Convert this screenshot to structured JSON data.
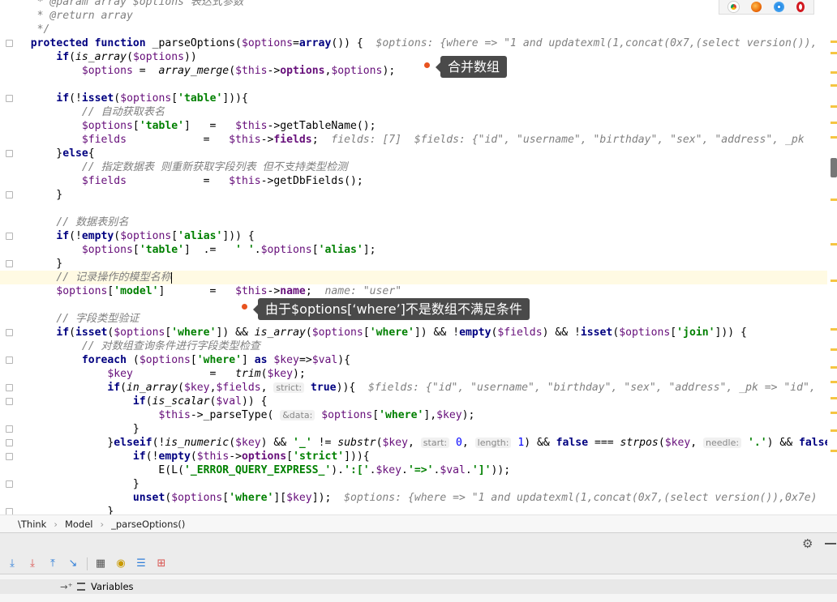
{
  "code_lines": [
    [
      [
        "doc",
        "   * "
      ],
      [
        "doc",
        "@param"
      ],
      [
        "doc",
        " array $options 表达式参数"
      ]
    ],
    [
      [
        "doc",
        "   * "
      ],
      [
        "doc",
        "@return"
      ],
      [
        "doc",
        " array"
      ]
    ],
    [
      [
        "doc",
        "   */"
      ]
    ],
    [
      [
        "plain",
        "  "
      ],
      [
        "kw",
        "protected function "
      ],
      [
        "plain",
        "_parseOptions("
      ],
      [
        "var",
        "$options"
      ],
      [
        "plain",
        "="
      ],
      [
        "kw",
        "array"
      ],
      [
        "plain",
        "()) {  "
      ],
      [
        "inl",
        "$options: {where => \"1 and updatexml(1,concat(0x7,(select version()),"
      ]
    ],
    [
      [
        "plain",
        "      "
      ],
      [
        "kw",
        "if"
      ],
      [
        "plain",
        "("
      ],
      [
        "fn",
        "is_array"
      ],
      [
        "plain",
        "("
      ],
      [
        "var",
        "$options"
      ],
      [
        "plain",
        "))"
      ]
    ],
    [
      [
        "plain",
        "          "
      ],
      [
        "var",
        "$options"
      ],
      [
        "plain",
        " =  "
      ],
      [
        "fn",
        "array_merge"
      ],
      [
        "plain",
        "("
      ],
      [
        "var",
        "$this"
      ],
      [
        "plain",
        "->"
      ],
      [
        "fld",
        "options"
      ],
      [
        "plain",
        ","
      ],
      [
        "var",
        "$options"
      ],
      [
        "plain",
        ");"
      ]
    ],
    [
      [
        "plain",
        ""
      ]
    ],
    [
      [
        "plain",
        "      "
      ],
      [
        "kw",
        "if"
      ],
      [
        "plain",
        "(!"
      ],
      [
        "kw",
        "isset"
      ],
      [
        "plain",
        "("
      ],
      [
        "var",
        "$options"
      ],
      [
        "plain",
        "["
      ],
      [
        "str",
        "'table'"
      ],
      [
        "plain",
        "])){"
      ]
    ],
    [
      [
        "plain",
        "          "
      ],
      [
        "com",
        "// 自动获取表名"
      ]
    ],
    [
      [
        "plain",
        "          "
      ],
      [
        "var",
        "$options"
      ],
      [
        "plain",
        "["
      ],
      [
        "str",
        "'table'"
      ],
      [
        "plain",
        "]   =   "
      ],
      [
        "var",
        "$this"
      ],
      [
        "plain",
        "->getTableName();"
      ]
    ],
    [
      [
        "plain",
        "          "
      ],
      [
        "var",
        "$fields"
      ],
      [
        "plain",
        "            =   "
      ],
      [
        "var",
        "$this"
      ],
      [
        "plain",
        "->"
      ],
      [
        "fld",
        "fields"
      ],
      [
        "plain",
        ";  "
      ],
      [
        "inl",
        "fields: [7]  $fields: {\"id\", \"username\", \"birthday\", \"sex\", \"address\", _pk"
      ]
    ],
    [
      [
        "plain",
        "      }"
      ],
      [
        "kw",
        "else"
      ],
      [
        "plain",
        "{"
      ]
    ],
    [
      [
        "plain",
        "          "
      ],
      [
        "com",
        "// 指定数据表 则重新获取字段列表 但不支持类型检测"
      ]
    ],
    [
      [
        "plain",
        "          "
      ],
      [
        "var",
        "$fields"
      ],
      [
        "plain",
        "            =   "
      ],
      [
        "var",
        "$this"
      ],
      [
        "plain",
        "->getDbFields();"
      ]
    ],
    [
      [
        "plain",
        "      }"
      ]
    ],
    [
      [
        "plain",
        ""
      ]
    ],
    [
      [
        "plain",
        "      "
      ],
      [
        "com",
        "// 数据表别名"
      ]
    ],
    [
      [
        "plain",
        "      "
      ],
      [
        "kw",
        "if"
      ],
      [
        "plain",
        "(!"
      ],
      [
        "kw",
        "empty"
      ],
      [
        "plain",
        "("
      ],
      [
        "var",
        "$options"
      ],
      [
        "plain",
        "["
      ],
      [
        "str",
        "'alias'"
      ],
      [
        "plain",
        "])) {"
      ]
    ],
    [
      [
        "plain",
        "          "
      ],
      [
        "var",
        "$options"
      ],
      [
        "plain",
        "["
      ],
      [
        "str",
        "'table'"
      ],
      [
        "plain",
        "]  .=   "
      ],
      [
        "str",
        "' '"
      ],
      [
        "plain",
        "."
      ],
      [
        "var",
        "$options"
      ],
      [
        "plain",
        "["
      ],
      [
        "str",
        "'alias'"
      ],
      [
        "plain",
        "];"
      ]
    ],
    [
      [
        "plain",
        "      }"
      ]
    ],
    [
      [
        "plain",
        "      "
      ],
      [
        "com",
        "// 记录操作的模型名称"
      ],
      [
        "caret",
        ""
      ]
    ],
    [
      [
        "plain",
        "      "
      ],
      [
        "var",
        "$options"
      ],
      [
        "plain",
        "["
      ],
      [
        "str",
        "'model'"
      ],
      [
        "plain",
        "]       =   "
      ],
      [
        "var",
        "$this"
      ],
      [
        "plain",
        "->"
      ],
      [
        "fld",
        "name"
      ],
      [
        "plain",
        ";  "
      ],
      [
        "inl",
        "name: \"user\""
      ]
    ],
    [
      [
        "plain",
        ""
      ]
    ],
    [
      [
        "plain",
        "      "
      ],
      [
        "com",
        "// 字段类型验证"
      ]
    ],
    [
      [
        "plain",
        "      "
      ],
      [
        "kw",
        "if"
      ],
      [
        "plain",
        "("
      ],
      [
        "kw",
        "isset"
      ],
      [
        "plain",
        "("
      ],
      [
        "var",
        "$options"
      ],
      [
        "plain",
        "["
      ],
      [
        "str",
        "'where'"
      ],
      [
        "plain",
        "]) && "
      ],
      [
        "fn",
        "is_array"
      ],
      [
        "plain",
        "("
      ],
      [
        "var",
        "$options"
      ],
      [
        "plain",
        "["
      ],
      [
        "str",
        "'where'"
      ],
      [
        "plain",
        "]) && !"
      ],
      [
        "kw",
        "empty"
      ],
      [
        "plain",
        "("
      ],
      [
        "var",
        "$fields"
      ],
      [
        "plain",
        ") && !"
      ],
      [
        "kw",
        "isset"
      ],
      [
        "plain",
        "("
      ],
      [
        "var",
        "$options"
      ],
      [
        "plain",
        "["
      ],
      [
        "str",
        "'join'"
      ],
      [
        "plain",
        "])) {"
      ]
    ],
    [
      [
        "plain",
        "          "
      ],
      [
        "com",
        "// 对数组查询条件进行字段类型检查"
      ]
    ],
    [
      [
        "plain",
        "          "
      ],
      [
        "kw",
        "foreach "
      ],
      [
        "plain",
        "("
      ],
      [
        "var",
        "$options"
      ],
      [
        "plain",
        "["
      ],
      [
        "str",
        "'where'"
      ],
      [
        "plain",
        "] "
      ],
      [
        "kw",
        "as "
      ],
      [
        "var",
        "$key"
      ],
      [
        "plain",
        "=>"
      ],
      [
        "var",
        "$val"
      ],
      [
        "plain",
        "){"
      ]
    ],
    [
      [
        "plain",
        "              "
      ],
      [
        "var",
        "$key"
      ],
      [
        "plain",
        "            =   "
      ],
      [
        "fn",
        "trim"
      ],
      [
        "plain",
        "("
      ],
      [
        "var",
        "$key"
      ],
      [
        "plain",
        ");"
      ]
    ],
    [
      [
        "plain",
        "              "
      ],
      [
        "kw",
        "if"
      ],
      [
        "plain",
        "("
      ],
      [
        "fn",
        "in_array"
      ],
      [
        "plain",
        "("
      ],
      [
        "var",
        "$key"
      ],
      [
        "plain",
        ","
      ],
      [
        "var",
        "$fields"
      ],
      [
        "plain",
        ", "
      ],
      [
        "hint",
        "strict:"
      ],
      [
        "plain",
        " "
      ],
      [
        "kw",
        "true"
      ],
      [
        "plain",
        ")){  "
      ],
      [
        "inl",
        "$fields: {\"id\", \"username\", \"birthday\", \"sex\", \"address\", _pk => \"id\","
      ]
    ],
    [
      [
        "plain",
        "                  "
      ],
      [
        "kw",
        "if"
      ],
      [
        "plain",
        "("
      ],
      [
        "fn",
        "is_scalar"
      ],
      [
        "plain",
        "("
      ],
      [
        "var",
        "$val"
      ],
      [
        "plain",
        ")) {"
      ]
    ],
    [
      [
        "plain",
        "                      "
      ],
      [
        "var",
        "$this"
      ],
      [
        "plain",
        "->_parseType( "
      ],
      [
        "hint",
        "&data:"
      ],
      [
        "plain",
        " "
      ],
      [
        "var",
        "$options"
      ],
      [
        "plain",
        "["
      ],
      [
        "str",
        "'where'"
      ],
      [
        "plain",
        "],"
      ],
      [
        "var",
        "$key"
      ],
      [
        "plain",
        ");"
      ]
    ],
    [
      [
        "plain",
        "                  }"
      ]
    ],
    [
      [
        "plain",
        "              }"
      ],
      [
        "kw",
        "elseif"
      ],
      [
        "plain",
        "(!"
      ],
      [
        "fn",
        "is_numeric"
      ],
      [
        "plain",
        "("
      ],
      [
        "var",
        "$key"
      ],
      [
        "plain",
        ") && "
      ],
      [
        "str",
        "'_'"
      ],
      [
        "plain",
        " != "
      ],
      [
        "fn",
        "substr"
      ],
      [
        "plain",
        "("
      ],
      [
        "var",
        "$key"
      ],
      [
        "plain",
        ", "
      ],
      [
        "hint",
        "start:"
      ],
      [
        "plain",
        " "
      ],
      [
        "num",
        "0"
      ],
      [
        "plain",
        ", "
      ],
      [
        "hint",
        "length:"
      ],
      [
        "plain",
        " "
      ],
      [
        "num",
        "1"
      ],
      [
        "plain",
        ") && "
      ],
      [
        "kw",
        "false"
      ],
      [
        "plain",
        " === "
      ],
      [
        "fn",
        "strpos"
      ],
      [
        "plain",
        "("
      ],
      [
        "var",
        "$key"
      ],
      [
        "plain",
        ", "
      ],
      [
        "hint",
        "needle:"
      ],
      [
        "plain",
        " "
      ],
      [
        "str",
        "'.'"
      ],
      [
        "plain",
        ") && "
      ],
      [
        "kw",
        "false"
      ]
    ],
    [
      [
        "plain",
        "                  "
      ],
      [
        "kw",
        "if"
      ],
      [
        "plain",
        "(!"
      ],
      [
        "kw",
        "empty"
      ],
      [
        "plain",
        "("
      ],
      [
        "var",
        "$this"
      ],
      [
        "plain",
        "->"
      ],
      [
        "fld",
        "options"
      ],
      [
        "plain",
        "["
      ],
      [
        "str",
        "'strict'"
      ],
      [
        "plain",
        "])){"
      ]
    ],
    [
      [
        "plain",
        "                      E(L("
      ],
      [
        "str",
        "'_ERROR_QUERY_EXPRESS_'"
      ],
      [
        "plain",
        ")."
      ],
      [
        "str",
        "':['"
      ],
      [
        "plain",
        "."
      ],
      [
        "var",
        "$key"
      ],
      [
        "plain",
        "."
      ],
      [
        "str",
        "'=>'"
      ],
      [
        "plain",
        "."
      ],
      [
        "var",
        "$val"
      ],
      [
        "plain",
        "."
      ],
      [
        "str",
        "']'"
      ],
      [
        "plain",
        "));"
      ]
    ],
    [
      [
        "plain",
        "                  }"
      ]
    ],
    [
      [
        "plain",
        "                  "
      ],
      [
        "kw",
        "unset"
      ],
      [
        "plain",
        "("
      ],
      [
        "var",
        "$options"
      ],
      [
        "plain",
        "["
      ],
      [
        "str",
        "'where'"
      ],
      [
        "plain",
        "]["
      ],
      [
        "var",
        "$key"
      ],
      [
        "plain",
        "]);  "
      ],
      [
        "inl",
        "$options: {where => \"1 and updatexml(1,concat(0x7,(select version()),0x7e)"
      ]
    ],
    [
      [
        "plain",
        "              }"
      ]
    ]
  ],
  "tooltips": {
    "merge": "合并数组",
    "where": "由于$options[‘where’]不是数组不满足条件"
  },
  "breadcrumb": [
    "\\Think",
    "Model",
    "_parseOptions()"
  ],
  "panel": {
    "variables_label": "Variables"
  },
  "icons": {
    "browsers": [
      "chrome-icon",
      "firefox-icon",
      "safari-icon",
      "opera-icon"
    ],
    "toolbar": [
      "step-over-icon",
      "step-into-icon",
      "step-out-icon",
      "run-to-cursor-icon",
      "evaluate-icon",
      "watch-icon",
      "frames-icon",
      "add-watch-icon"
    ]
  },
  "colors": {
    "keyword": "#000080",
    "variable": "#660e7a",
    "string": "#008000",
    "comment": "#808080",
    "tooltip_bg": "#4a4a4a",
    "marker": "#e8531f"
  }
}
